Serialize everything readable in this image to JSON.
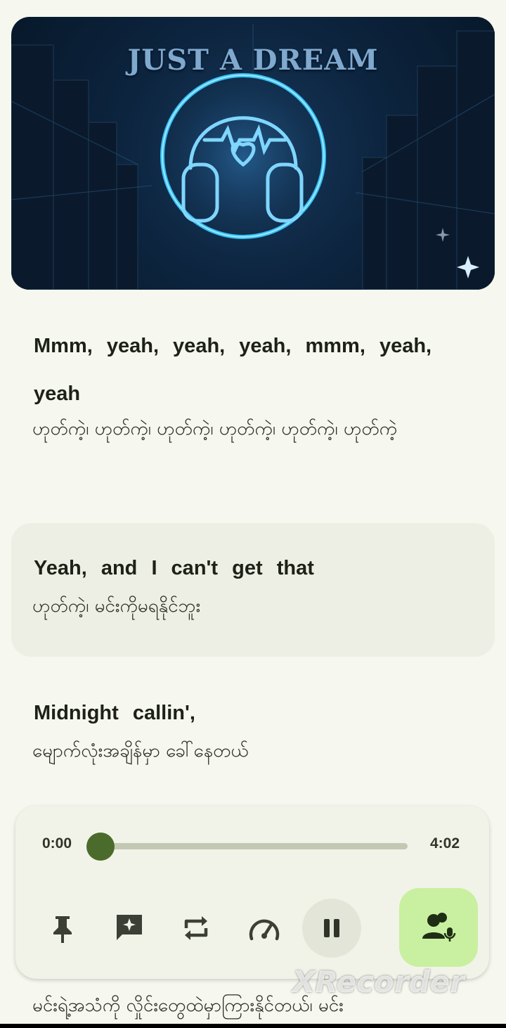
{
  "cover": {
    "title": "JUST A DREAM"
  },
  "lyrics": [
    {
      "en": "Mmm, yeah, yeah, yeah, mmm, yeah, yeah",
      "mm": "ဟုတ်ကဲ့၊ ဟုတ်ကဲ့၊ ဟုတ်ကဲ့၊ ဟုတ်ကဲ့၊ ဟုတ်ကဲ့၊ ဟုတ်ကဲ့"
    },
    {
      "en": "Yeah, and I can't get that",
      "mm": "ဟုတ်ကဲ့၊ မင်းကိုမရနိုင်ဘူး",
      "active": true
    },
    {
      "en": "Midnight callin',",
      "mm": "မျောက်လုံးအချိန်မှာ ခေါ်နေတယ်"
    },
    {
      "en": "",
      "mm": "မင်းရဲ့အသံကို လှိုင်းတွေထဲမှာကြားနိုင်တယ်၊ မင်း"
    }
  ],
  "player": {
    "current_time": "0:00",
    "total_time": "4:02",
    "progress": 0.0
  },
  "controls": [
    "pin-icon",
    "ai-comment-icon",
    "repeat-icon",
    "speed-icon",
    "pause-icon",
    "voice-icon"
  ],
  "colors": {
    "accent": "#4a6b2c",
    "mic_bg": "#c8f0a0",
    "background": "#f6f7ee"
  },
  "watermark": "XRecorder"
}
